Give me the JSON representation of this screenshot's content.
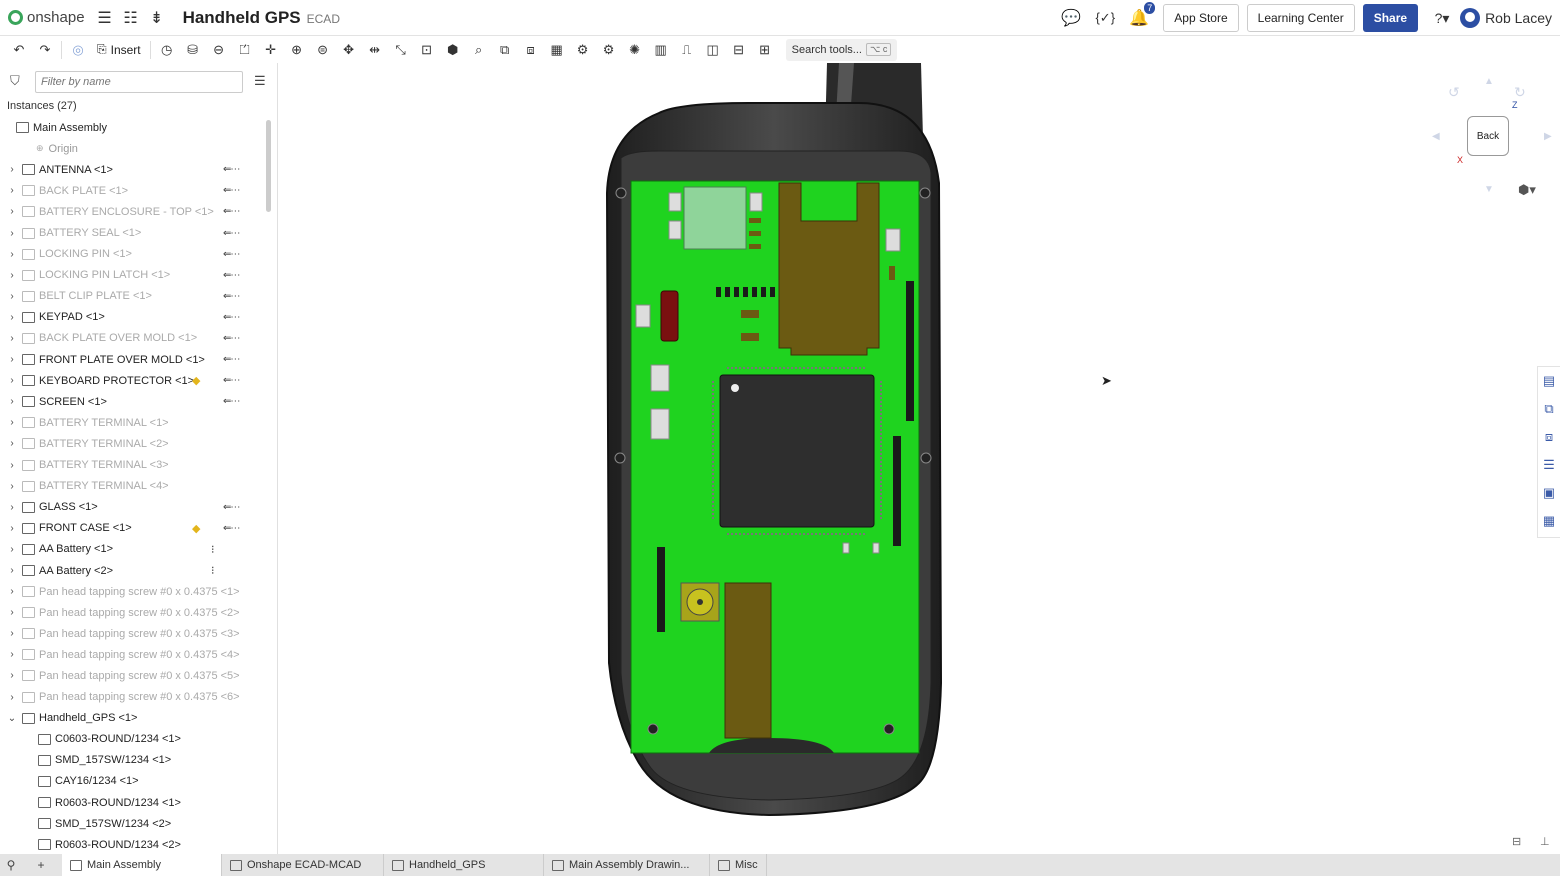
{
  "app": {
    "brand": "onshape",
    "document_title": "Handheld GPS",
    "workspace": "ECAD"
  },
  "topbar": {
    "notifications_count": "7",
    "app_store": "App Store",
    "learning_center": "Learning Center",
    "share": "Share",
    "user_name": "Rob Lacey"
  },
  "toolbar": {
    "insert_label": "Insert",
    "search_tools": "Search tools...",
    "search_shortcut": "⌥ c"
  },
  "panel": {
    "filter_placeholder": "Filter by name",
    "instances_header": "Instances (27)",
    "tree": [
      {
        "label": "Main Assembly",
        "state": "root"
      },
      {
        "label": "Origin",
        "state": "origin"
      },
      {
        "label": "ANTENNA <1>",
        "state": "normal",
        "mate": true
      },
      {
        "label": "BACK PLATE <1>",
        "state": "suppressed",
        "mate": true
      },
      {
        "label": "BATTERY ENCLOSURE - TOP <1>",
        "state": "suppressed",
        "mate": true
      },
      {
        "label": "BATTERY SEAL <1>",
        "state": "suppressed",
        "mate": true
      },
      {
        "label": "LOCKING PIN <1>",
        "state": "suppressed",
        "mate": true
      },
      {
        "label": "LOCKING PIN LATCH <1>",
        "state": "suppressed",
        "mate": true
      },
      {
        "label": "BELT CLIP PLATE <1>",
        "state": "suppressed",
        "mate": true
      },
      {
        "label": "KEYPAD <1>",
        "state": "normal",
        "mate": true
      },
      {
        "label": "BACK PLATE OVER MOLD <1>",
        "state": "suppressed",
        "mate": true
      },
      {
        "label": "FRONT PLATE OVER MOLD <1>",
        "state": "normal",
        "mate": true
      },
      {
        "label": "KEYBOARD PROTECTOR <1>",
        "state": "normal",
        "mate": true,
        "gem": true
      },
      {
        "label": "SCREEN <1>",
        "state": "normal",
        "mate": true
      },
      {
        "label": "BATTERY TERMINAL <1>",
        "state": "suppressed"
      },
      {
        "label": "BATTERY TERMINAL <2>",
        "state": "suppressed"
      },
      {
        "label": "BATTERY TERMINAL <3>",
        "state": "suppressed"
      },
      {
        "label": "BATTERY TERMINAL <4>",
        "state": "suppressed"
      },
      {
        "label": "GLASS <1>",
        "state": "normal",
        "mate": true
      },
      {
        "label": "FRONT CASE <1>",
        "state": "normal",
        "mate": true,
        "gem": true
      },
      {
        "label": "AA Battery <1>",
        "state": "normal",
        "dot": true
      },
      {
        "label": "AA Battery <2>",
        "state": "normal",
        "dot": true
      },
      {
        "label": "Pan head tapping screw #0 x 0.4375 <1>",
        "state": "suppressed"
      },
      {
        "label": "Pan head tapping screw #0 x 0.4375 <2>",
        "state": "suppressed"
      },
      {
        "label": "Pan head tapping screw #0 x 0.4375 <3>",
        "state": "suppressed"
      },
      {
        "label": "Pan head tapping screw #0 x 0.4375 <4>",
        "state": "suppressed"
      },
      {
        "label": "Pan head tapping screw #0 x 0.4375 <5>",
        "state": "suppressed"
      },
      {
        "label": "Pan head tapping screw #0 x 0.4375 <6>",
        "state": "suppressed"
      },
      {
        "label": "Handheld_GPS <1>",
        "state": "expanded"
      },
      {
        "label": "C0603-ROUND/1234 <1>",
        "state": "child"
      },
      {
        "label": "SMD_157SW/1234 <1>",
        "state": "child"
      },
      {
        "label": "CAY16/1234 <1>",
        "state": "child"
      },
      {
        "label": "R0603-ROUND/1234 <1>",
        "state": "child"
      },
      {
        "label": "SMD_157SW/1234 <2>",
        "state": "child"
      },
      {
        "label": "R0603-ROUND/1234 <2>",
        "state": "child"
      }
    ]
  },
  "viewcube": {
    "face": "Back",
    "axis_z": "Z",
    "axis_x": "X"
  },
  "tabs": [
    {
      "label": "Main Assembly",
      "active": true
    },
    {
      "label": "Onshape ECAD-MCAD",
      "active": false
    },
    {
      "label": "Handheld_GPS",
      "active": false
    },
    {
      "label": "Main Assembly Drawin...",
      "active": false
    },
    {
      "label": "Misc",
      "active": false
    }
  ],
  "colors": {
    "pcb": "#1fd31f",
    "chip": "#2e2e2e",
    "case": "#3a3a3a",
    "accent": "#2c4ea3"
  }
}
